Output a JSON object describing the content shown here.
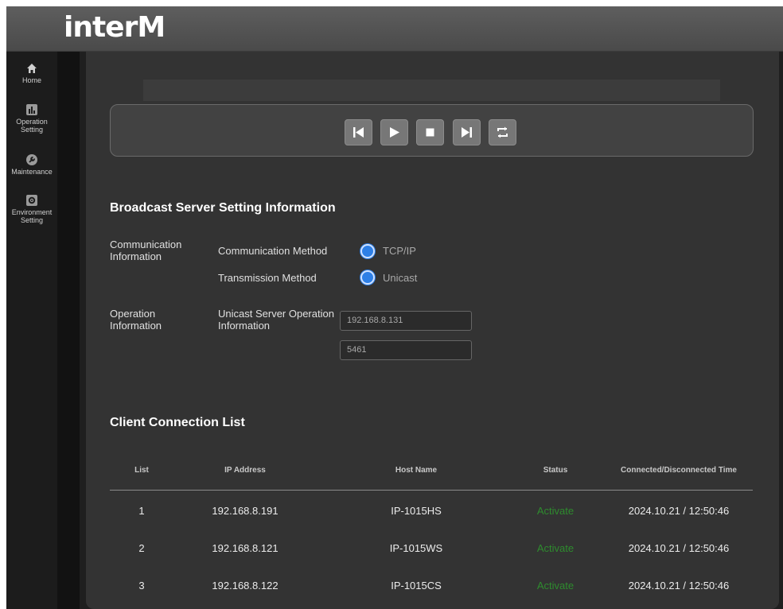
{
  "header": {
    "logo_text": "interM"
  },
  "sidebar": {
    "items": [
      {
        "label": "Home",
        "icon": "home-icon"
      },
      {
        "label": "Operation Setting",
        "icon": "chart-icon"
      },
      {
        "label": "Maintenance",
        "icon": "wrench-icon"
      },
      {
        "label": "Environment Setting",
        "icon": "gear-icon"
      }
    ]
  },
  "player": {
    "buttons": [
      "skip-previous-icon",
      "play-icon",
      "stop-icon",
      "skip-next-icon",
      "repeat-icon"
    ]
  },
  "server_settings": {
    "title": "Broadcast Server Setting Information",
    "communication_info_label": "Communication Information",
    "communication_method_label": "Communication Method",
    "communication_method_value": "TCP/IP",
    "transmission_method_label": "Transmission Method",
    "transmission_method_value": "Unicast",
    "operation_info_label": "Operation Information",
    "unicast_server_label": "Unicast Server Operation Information",
    "server_ip": "192.168.8.131",
    "server_port": "5461"
  },
  "clients": {
    "title": "Client Connection List",
    "columns": [
      "List",
      "IP Address",
      "Host Name",
      "Status",
      "Connected/Disconnected Time"
    ],
    "rows": [
      {
        "list": "1",
        "ip": "192.168.8.191",
        "host": "IP-1015HS",
        "status": "Activate",
        "time": "2024.10.21 / 12:50:46"
      },
      {
        "list": "2",
        "ip": "192.168.8.121",
        "host": "IP-1015WS",
        "status": "Activate",
        "time": "2024.10.21 / 12:50:46"
      },
      {
        "list": "3",
        "ip": "192.168.8.122",
        "host": "IP-1015CS",
        "status": "Activate",
        "time": "2024.10.21 / 12:50:46"
      }
    ]
  },
  "colors": {
    "accent": "#2d7fe6",
    "status_active": "#2e8b2e",
    "panel": "#333333"
  }
}
